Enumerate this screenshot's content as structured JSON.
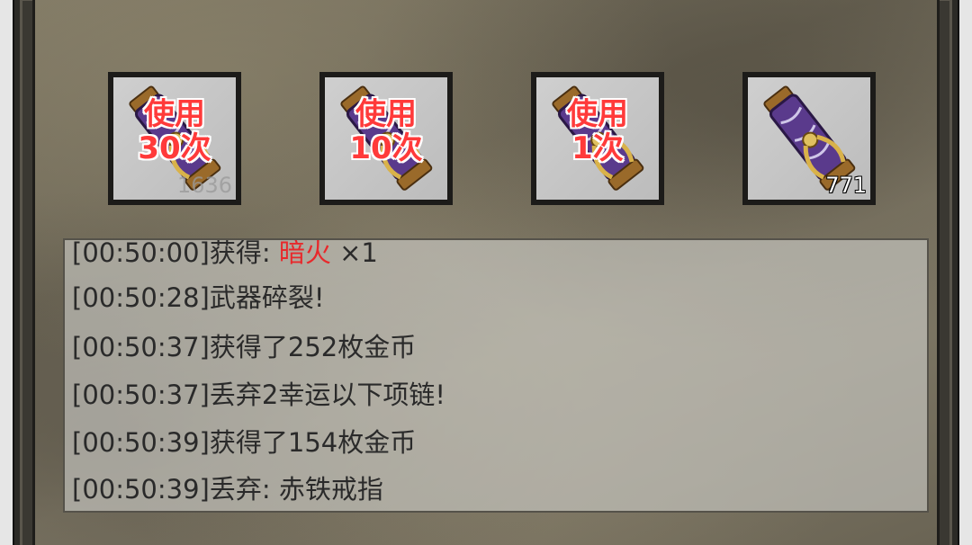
{
  "items": [
    {
      "id": "scroll-use-30",
      "label": "使用\n30次",
      "count": "1636",
      "count_faded": true
    },
    {
      "id": "scroll-use-10",
      "label": "使用\n10次",
      "count": "",
      "count_faded": false
    },
    {
      "id": "scroll-use-1",
      "label": "使用\n1次",
      "count": "",
      "count_faded": false
    },
    {
      "id": "scroll-stack",
      "label": "",
      "count": "771",
      "count_faded": false
    }
  ],
  "log": {
    "line0": {
      "pre": "[00:50:00]获得: ",
      "highlight": "暗火",
      "post": " ×1"
    },
    "line1": "[00:50:28]武器碎裂!",
    "line2": "[00:50:37]获得了252枚金币",
    "line3": "[00:50:37]丢弃2幸运以下项链!",
    "line4": "[00:50:39]获得了154枚金币",
    "line5": "[00:50:39]丢弃: 赤铁戒指"
  },
  "colors": {
    "highlight_red": "#e8282b",
    "use_label_red": "#ff3a3a",
    "scroll_purple": "#5a3a8c"
  },
  "icons": [
    "scroll-icon"
  ]
}
